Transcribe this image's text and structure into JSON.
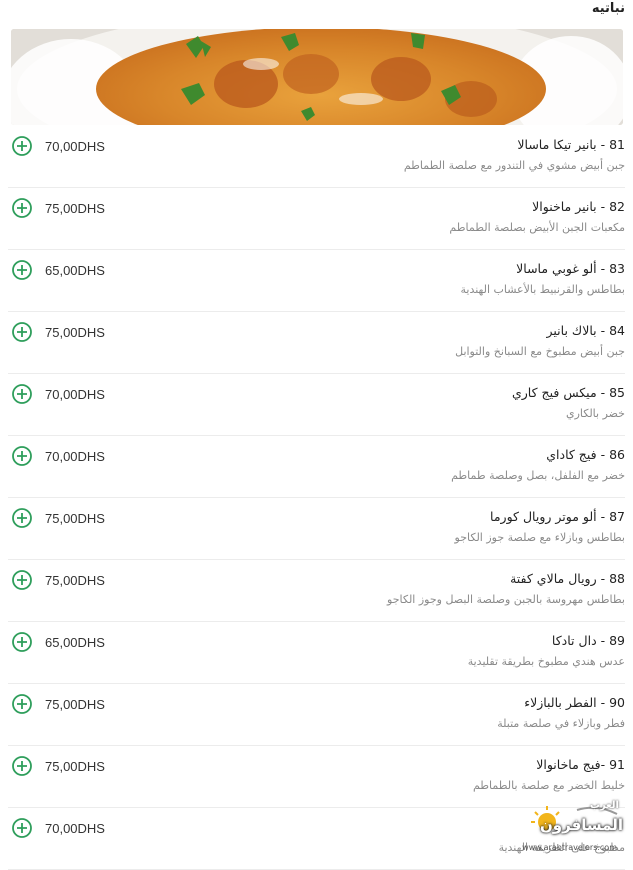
{
  "section": {
    "title": "نباتيه"
  },
  "hero": {
    "image_alt": "curry-dish-photo"
  },
  "items": [
    {
      "name": "81 - بانير تيكا ماسالا",
      "description": "جبن أبيض مشوي في التندور مع صلصة الطماطم",
      "price": "70,00DHS"
    },
    {
      "name": "82 - بانير ماخنوالا",
      "description": "مكعبات الجبن الأبيض بصلصة الطماطم",
      "price": "75,00DHS"
    },
    {
      "name": "83 - ألو غوبي ماسالا",
      "description": "بطاطس والقرنبيط بالأعشاب الهندية",
      "price": "65,00DHS"
    },
    {
      "name": "84 - بالاك بانير",
      "description": "جبن أبيض مطبوخ مع السبانخ والتوابل",
      "price": "75,00DHS"
    },
    {
      "name": "85 - ميكس فيج كاري",
      "description": "خضر بالكاري",
      "price": "70,00DHS"
    },
    {
      "name": "86 - فيج كاداي",
      "description": "خضر مع الفلفل، بصل وصلصة طماطم",
      "price": "70,00DHS"
    },
    {
      "name": "87 - ألو موتر رويال كورما",
      "description": "بطاطس وبازلاء مع صلصة جوز الكاجو",
      "price": "75,00DHS"
    },
    {
      "name": "88 - رويال مالاي كفتة",
      "description": "بطاطس مهروسة بالجبن وصلصة البصل وجوز الكاجو",
      "price": "75,00DHS"
    },
    {
      "name": "89 - دال تادكا",
      "description": "عدس هندي مطبوخ بطريقة تقليدية",
      "price": "65,00DHS"
    },
    {
      "name": "90 - الفطر بالبازلاء",
      "description": "فطر وبازلاء في صلصة متبلة",
      "price": "75,00DHS"
    },
    {
      "name": "91 -فيج ماخانوالا",
      "description": "خليط الخضر مع صلصة بالطماطم",
      "price": "75,00DHS"
    },
    {
      "name": "",
      "description": "مطبوخ على الطريقة الهندية",
      "price": "70,00DHS"
    }
  ],
  "watermark": {
    "top_text": "العرب",
    "main_text": "المسافرون",
    "url": "www.arabtravelers.com"
  },
  "colors": {
    "add_icon": "#2e9e5b",
    "price": "#333333",
    "description": "#8a8a8a"
  }
}
